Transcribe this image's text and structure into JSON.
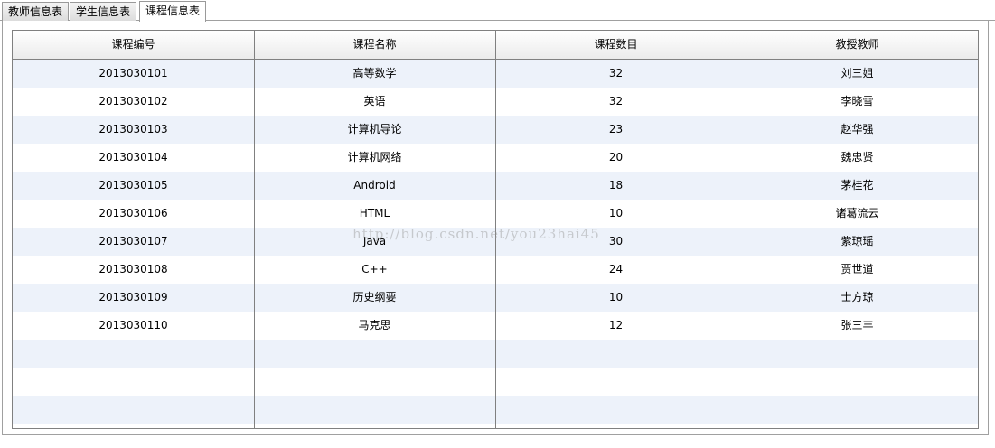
{
  "tabs": [
    {
      "label": "教师信息表"
    },
    {
      "label": "学生信息表"
    },
    {
      "label": "课程信息表"
    }
  ],
  "table": {
    "columns": [
      "课程编号",
      "课程名称",
      "课程数目",
      "教授教师"
    ],
    "rows": [
      [
        "2013030101",
        "高等数学",
        "32",
        "刘三姐"
      ],
      [
        "2013030102",
        "英语",
        "32",
        "李晓雪"
      ],
      [
        "2013030103",
        "计算机导论",
        "23",
        "赵华强"
      ],
      [
        "2013030104",
        "计算机网络",
        "20",
        "魏忠贤"
      ],
      [
        "2013030105",
        "Android",
        "18",
        "茅桂花"
      ],
      [
        "2013030106",
        "HTML",
        "10",
        "诸葛流云"
      ],
      [
        "2013030107",
        "Java",
        "30",
        "紫琼瑶"
      ],
      [
        "2013030108",
        "C++",
        "24",
        "贾世道"
      ],
      [
        "2013030109",
        "历史纲要",
        "10",
        "士方琼"
      ],
      [
        "2013030110",
        "马克思",
        "12",
        "张三丰"
      ]
    ]
  },
  "watermark": "http://blog.csdn.net/you23hai45"
}
